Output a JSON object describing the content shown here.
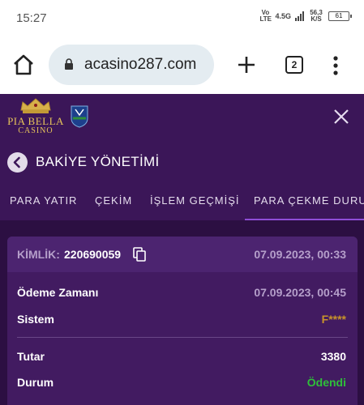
{
  "status_bar": {
    "time": "15:27",
    "network": "Vo LTE",
    "net_type": "4.5G",
    "speed": "56,3 K/S",
    "battery": "61"
  },
  "browser": {
    "url": "acasino287.com",
    "tab_count": "2"
  },
  "site": {
    "logo_line1": "PIA BELLA",
    "logo_line2": "CASINO"
  },
  "page": {
    "title": "BAKİYE YÖNETİMİ"
  },
  "tabs": [
    {
      "label": "PARA YATIR"
    },
    {
      "label": "ÇEKİM"
    },
    {
      "label": "İŞLEM GEÇMİŞİ"
    },
    {
      "label": "PARA ÇEKME DURUMU",
      "active": true
    }
  ],
  "withdrawal": {
    "id_label": "KİMLİK:",
    "id_value": "220690059",
    "created_at": "07.09.2023, 00:33",
    "payment_time_label": "Ödeme Zamanı",
    "payment_time_value": "07.09.2023, 00:45",
    "system_label": "Sistem",
    "system_value": "F****",
    "amount_label": "Tutar",
    "amount_value": "3380",
    "status_label": "Durum",
    "status_value": "Ödendi"
  },
  "colors": {
    "header_bg": "#3b1658",
    "content_bg": "#2c0f42",
    "card_bg": "#421b61",
    "system_value": "#c8932a",
    "status_paid": "#2fbf3a",
    "tab_active_indicator": "#8e4dd6"
  }
}
